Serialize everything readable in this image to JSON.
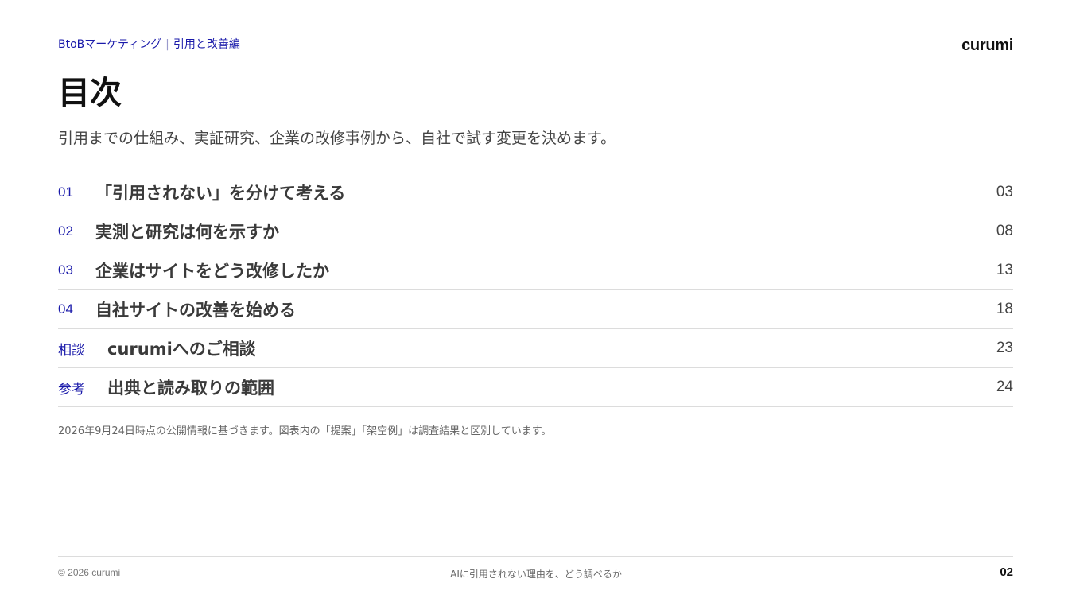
{
  "header": {
    "breadcrumb_primary": "BtoBマーケティング",
    "breadcrumb_separator": "|",
    "breadcrumb_secondary": "引用と改善編",
    "logo": "curumi"
  },
  "page": {
    "title": "目次",
    "subtitle": "引用までの仕組み、実証研究、企業の改修事例から、自社で試す変更を決めます。"
  },
  "toc": {
    "items": [
      {
        "number": "01",
        "title": "「引用されない」を分けて考える",
        "page": "03"
      },
      {
        "number": "02",
        "title": "実測と研究は何を示すか",
        "page": "08"
      },
      {
        "number": "03",
        "title": "企業はサイトをどう改修したか",
        "page": "13"
      },
      {
        "number": "04",
        "title": "自社サイトの改善を始める",
        "page": "18"
      },
      {
        "number": "相談",
        "title": "curumiへのご相談",
        "page": "23"
      },
      {
        "number": "参考",
        "title": "出典と読み取りの範囲",
        "page": "24"
      }
    ]
  },
  "note": "2026年9月24日時点の公開情報に基づきます。図表内の「提案」「架空例」は調査結果と区別しています。",
  "footer": {
    "copyright": "© 2026 curumi",
    "center": "AIに引用されない理由を、どう調べるか",
    "page_number": "02"
  },
  "colors": {
    "accent": "#1a1aaa",
    "text": "#333333",
    "rule": "#dcdcdc"
  }
}
